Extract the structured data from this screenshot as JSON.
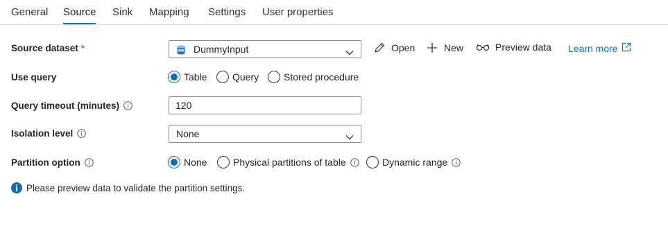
{
  "tabs": [
    {
      "label": "General"
    },
    {
      "label": "Source",
      "active": true
    },
    {
      "label": "Sink"
    },
    {
      "label": "Mapping"
    },
    {
      "label": "Settings"
    },
    {
      "label": "User properties"
    }
  ],
  "source_dataset": {
    "label": "Source dataset",
    "required_mark": "*",
    "value": "DummyInput",
    "actions": {
      "open": "Open",
      "new": "New",
      "preview": "Preview data",
      "learn_more": "Learn more"
    }
  },
  "use_query": {
    "label": "Use query",
    "options": [
      "Table",
      "Query",
      "Stored procedure"
    ],
    "selected": "Table"
  },
  "query_timeout": {
    "label": "Query timeout (minutes)",
    "value": "120"
  },
  "isolation_level": {
    "label": "Isolation level",
    "value": "None"
  },
  "partition_option": {
    "label": "Partition option",
    "options": [
      "None",
      "Physical partitions of table",
      "Dynamic range"
    ],
    "selected": "None"
  },
  "message": {
    "text": "Please preview data to validate the partition settings."
  },
  "colors": {
    "accent": "#0f6cbd",
    "tab_underline": "#0078d4",
    "required": "#a4262c"
  }
}
